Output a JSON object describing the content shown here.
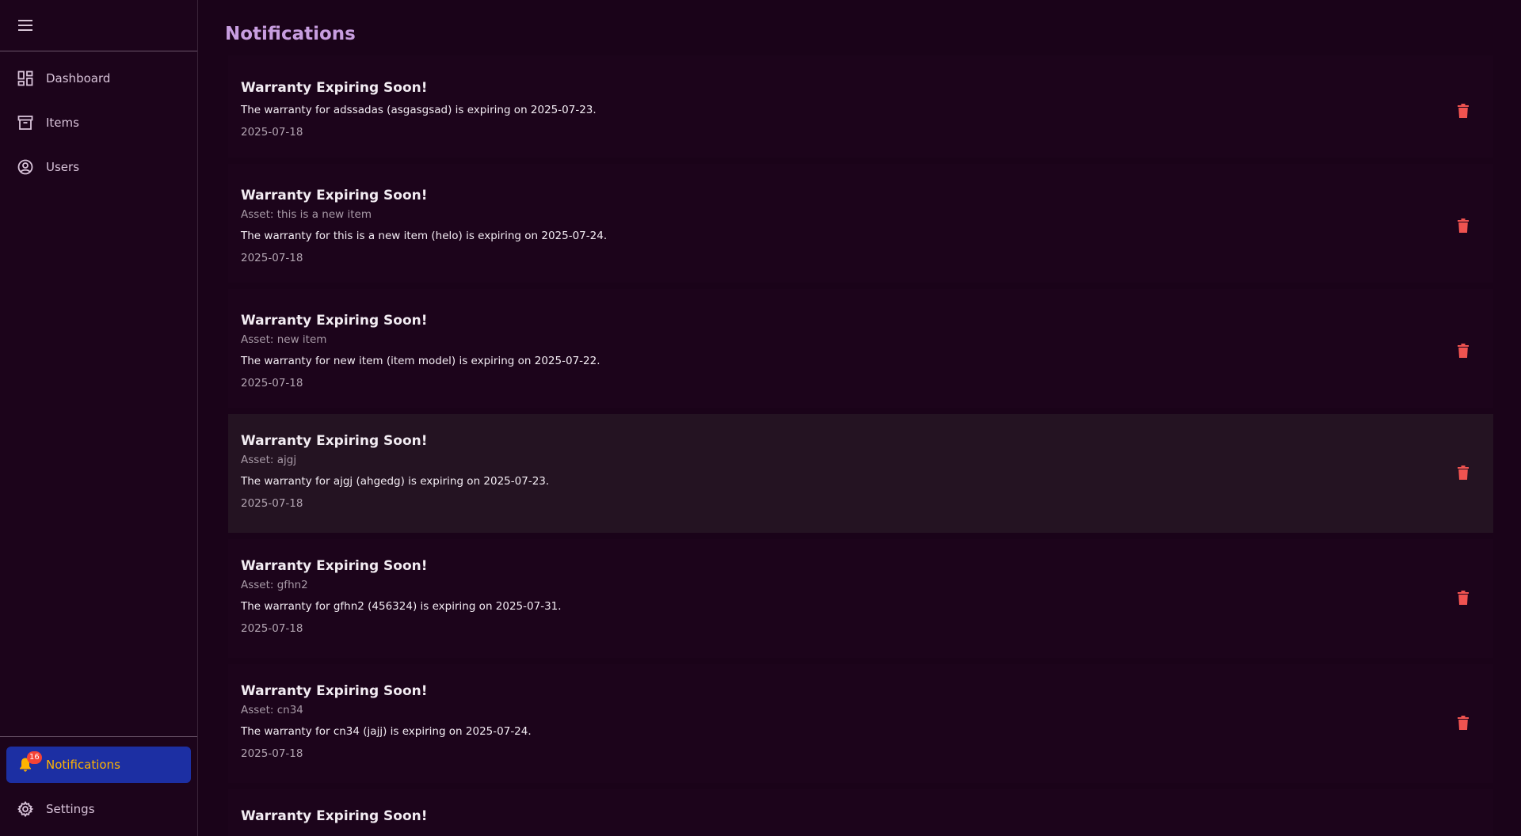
{
  "sidebar": {
    "items": [
      {
        "label": "Dashboard",
        "icon": "dashboard-icon"
      },
      {
        "label": "Items",
        "icon": "archive-icon"
      },
      {
        "label": "Users",
        "icon": "user-circle-icon"
      }
    ],
    "bottom_items": [
      {
        "label": "Notifications",
        "icon": "bell-icon",
        "badge": "16",
        "active": true
      },
      {
        "label": "Settings",
        "icon": "gear-icon"
      }
    ]
  },
  "main": {
    "title": "Notifications",
    "notifications": [
      {
        "title": "Warranty Expiring Soon!",
        "asset": "",
        "message": "The warranty for adssadas (asgasgsad) is expiring on 2025-07-23.",
        "date": "2025-07-18"
      },
      {
        "title": "Warranty Expiring Soon!",
        "asset": "Asset: this is a new item",
        "message": "The warranty for this is a new item (helo) is expiring on 2025-07-24.",
        "date": "2025-07-18"
      },
      {
        "title": "Warranty Expiring Soon!",
        "asset": "Asset: new item",
        "message": "The warranty for new item (item model) is expiring on 2025-07-22.",
        "date": "2025-07-18"
      },
      {
        "title": "Warranty Expiring Soon!",
        "asset": "Asset: ajgj",
        "message": "The warranty for ajgj (ahgedg) is expiring on 2025-07-23.",
        "date": "2025-07-18"
      },
      {
        "title": "Warranty Expiring Soon!",
        "asset": "Asset: gfhn2",
        "message": "The warranty for gfhn2 (456324) is expiring on 2025-07-31.",
        "date": "2025-07-18"
      },
      {
        "title": "Warranty Expiring Soon!",
        "asset": "Asset: cn34",
        "message": "The warranty for cn34 (jajj) is expiring on 2025-07-24.",
        "date": "2025-07-18"
      },
      {
        "title": "Warranty Expiring Soon!",
        "asset": "",
        "message": "",
        "date": ""
      }
    ]
  },
  "colors": {
    "background": "#1a0319",
    "title_accent": "#c89ee0",
    "active_nav_bg": "#1c2fa3",
    "active_nav_text": "#ffb300",
    "delete_icon": "#ef5350",
    "badge": "#f44336"
  }
}
